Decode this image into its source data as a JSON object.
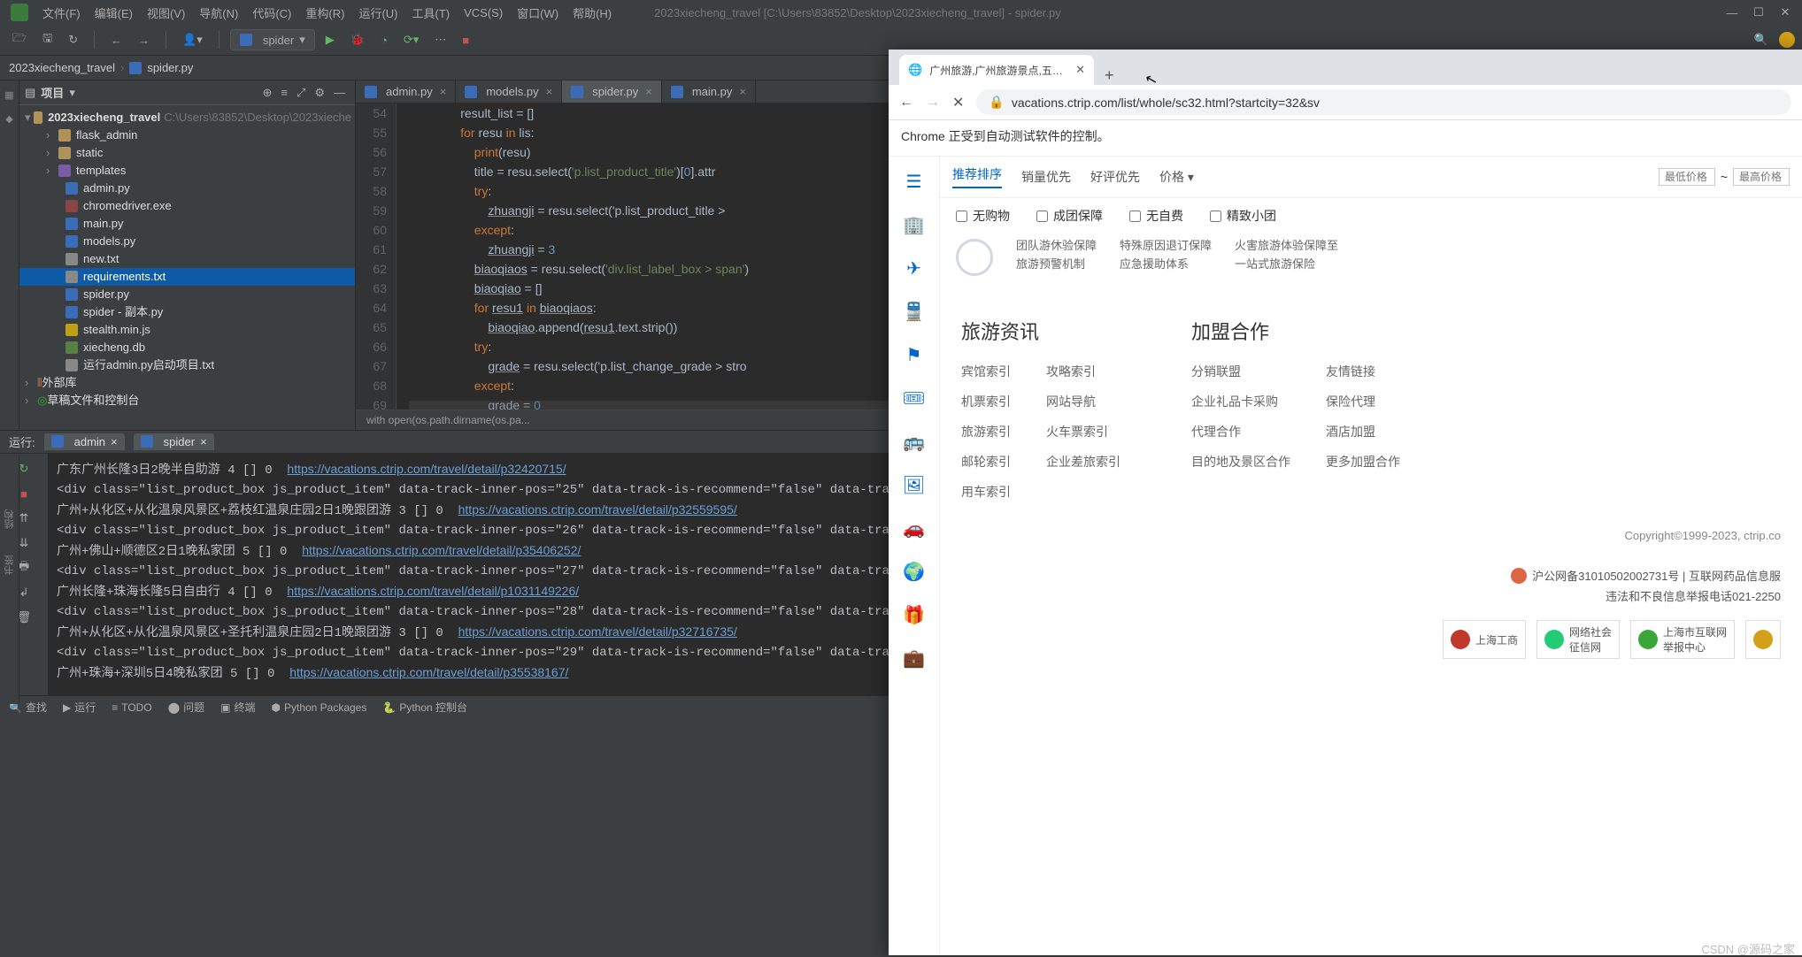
{
  "ide": {
    "title": "2023xiecheng_travel [C:\\Users\\83852\\Desktop\\2023xiecheng_travel] - spider.py",
    "menus": {
      "file": "文件(F)",
      "edit": "编辑(E)",
      "view": "视图(V)",
      "nav": "导航(N)",
      "code": "代码(C)",
      "refactor": "重构(R)",
      "run": "运行(U)",
      "tools": "工具(T)",
      "vcs": "VCS(S)",
      "window": "窗口(W)",
      "help": "帮助(H)"
    },
    "run_config": "spider",
    "breadcrumb": {
      "project": "2023xiecheng_travel",
      "file": "spider.py"
    },
    "project_label": "项目",
    "tree": {
      "root": {
        "name": "2023xiecheng_travel",
        "path": "C:\\Users\\83852\\Desktop\\2023xieche"
      },
      "dirs": {
        "flask_admin": "flask_admin",
        "static": "static",
        "templates": "templates"
      },
      "files": {
        "admin": "admin.py",
        "chromedriver": "chromedriver.exe",
        "main": "main.py",
        "models": "models.py",
        "new": "new.txt",
        "requirements": "requirements.txt",
        "spider": "spider.py",
        "spider_copy": "spider - 副本.py",
        "stealth": "stealth.min.js",
        "xiecheng": "xiecheng.db",
        "runadmin": "运行admin.py启动项目.txt"
      },
      "ext_libs": "外部库",
      "scratches": "草稿文件和控制台"
    },
    "tabs": {
      "admin": "admin.py",
      "models": "models.py",
      "spider": "spider.py",
      "main": "main.py"
    },
    "code": {
      "start": 54,
      "lines": [
        "                result_list = []",
        "                for resu in lis:",
        "                    print(resu)",
        "                    title = resu.select('p.list_product_title')[0].attr",
        "                    try:",
        "                        zhuangji = resu.select('p.list_product_title >",
        "                    except:",
        "                        zhuangji = 3",
        "                    biaoqiaos = resu.select('div.list_label_box > span')",
        "                    biaoqiao = []",
        "                    for resu1 in biaoqiaos:",
        "                        biaoqiao.append(resu1.text.strip())",
        "                    try:",
        "                        grade = resu.select('p.list_change_grade > stro",
        "                    except:",
        "                        grade = 0"
      ],
      "crumb": "with open(os.path.dirname(os.pa..."
    },
    "run": {
      "label": "运行:",
      "tab1": "admin",
      "tab2": "spider",
      "out": [
        {
          "t": "广东广州长隆3日2晚半自助游 4 [] 0  ",
          "l": "https://vacations.ctrip.com/travel/detail/p32420715/"
        },
        {
          "t": "<div class=\"list_product_box js_product_item\" data-track-inner-pos=\"25\" data-track-is-recommend=\"false\" data-track-p"
        },
        {
          "t": "广州+从化区+从化温泉风景区+荔枝红温泉庄园2日1晚跟团游 3 [] 0  ",
          "l": "https://vacations.ctrip.com/travel/detail/p32559595/"
        },
        {
          "t": "<div class=\"list_product_box js_product_item\" data-track-inner-pos=\"26\" data-track-is-recommend=\"false\" data-track-p"
        },
        {
          "t": "广州+佛山+顺德区2日1晚私家团 5 [] 0  ",
          "l": "https://vacations.ctrip.com/travel/detail/p35406252/"
        },
        {
          "t": "<div class=\"list_product_box js_product_item\" data-track-inner-pos=\"27\" data-track-is-recommend=\"false\" data-track-p"
        },
        {
          "t": "广州长隆+珠海长隆5日自由行 4 [] 0  ",
          "l": "https://vacations.ctrip.com/travel/detail/p1031149226/"
        },
        {
          "t": "<div class=\"list_product_box js_product_item\" data-track-inner-pos=\"28\" data-track-is-recommend=\"false\" data-track-p"
        },
        {
          "t": "广州+从化区+从化温泉风景区+圣托利温泉庄园2日1晚跟团游 3 [] 0  ",
          "l": "https://vacations.ctrip.com/travel/detail/p32716735/"
        },
        {
          "t": "<div class=\"list_product_box js_product_item\" data-track-inner-pos=\"29\" data-track-is-recommend=\"false\" data-track-p"
        },
        {
          "t": "广州+珠海+深圳5日4晚私家团 5 [] 0  ",
          "l": "https://vacations.ctrip.com/travel/detail/p35538167/"
        }
      ]
    },
    "status": {
      "find": "查找",
      "run": "运行",
      "todo": "TODO",
      "problems": "问题",
      "terminal": "终端",
      "pkg": "Python Packages",
      "console": "Python 控制台"
    },
    "gutter": {
      "structure": "结构",
      "bookmarks": "书签"
    }
  },
  "browser": {
    "tab_title": "广州旅游,广州旅游景点,五月广州",
    "addr": "vacations.ctrip.com/list/whole/sc32.html?startcity=32&sv",
    "banner": "Chrome 正受到自动测试软件的控制。",
    "filters": {
      "rec": "推荐排序",
      "sales": "销量优先",
      "rating": "好评优先",
      "price": "价格",
      "min": "最低价格",
      "max": "最高价格",
      "tilde": "~"
    },
    "checks": {
      "noshopping": "无购物",
      "group": "成团保障",
      "nofee": "无自费",
      "small": "精致小团"
    },
    "guarantees": {
      "g1a": "团队游休验保障",
      "g1b": "旅游预警机制",
      "g2a": "特殊原因退订保障",
      "g2b": "应急援助体系",
      "g3a": "火害旅游体验保障至",
      "g3b": "一站式旅游保险"
    },
    "foot1": {
      "title": "旅游资讯",
      "c1": [
        "宾馆索引",
        "机票索引",
        "旅游索引",
        "邮轮索引",
        "用车索引"
      ],
      "c2": [
        "攻略索引",
        "网站导航",
        "火车票索引",
        "企业差旅索引"
      ]
    },
    "foot2": {
      "title": "加盟合作",
      "c1": [
        "分销联盟",
        "企业礼品卡采购",
        "代理合作",
        "目的地及景区合作"
      ],
      "c2": [
        "友情链接",
        "保险代理",
        "酒店加盟",
        "更多加盟合作"
      ]
    },
    "copy": "Copyright©1999-2023, ctrip.co",
    "legal": "沪公网备31010502002731号 | 互联网药品信息服",
    "report": "违法和不良信息举报电话021-2250",
    "badges": {
      "b1": "上海工商",
      "b2": "网络社会\n征信网",
      "b3": "上海市互联网\n举报中心"
    }
  },
  "watermark": "CSDN @源码之家"
}
